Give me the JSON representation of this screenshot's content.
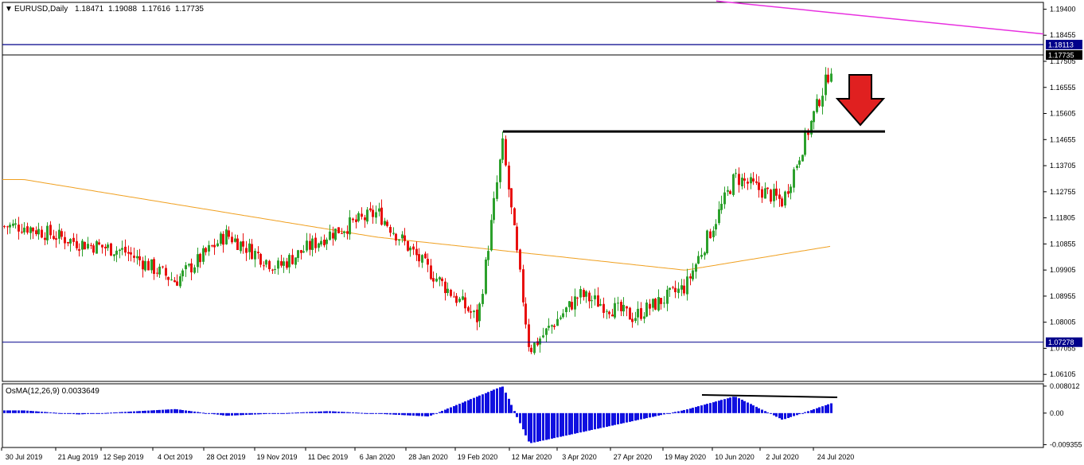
{
  "header": {
    "symbol": "EURUSD,Daily",
    "open": "1.18471",
    "high": "1.19088",
    "low": "1.17616",
    "close": "1.17735"
  },
  "osma": {
    "title": "OsMA(12,26,9) 0.0033649",
    "ticks": [
      "0.008012",
      "0.00",
      "-0.009355"
    ]
  },
  "price_axis_ticks": [
    "1.19400",
    "1.18455",
    "1.17505",
    "1.16555",
    "1.15605",
    "1.14655",
    "1.13705",
    "1.12755",
    "1.11805",
    "1.10855",
    "1.09905",
    "1.08955",
    "1.08005",
    "1.07055",
    "1.06105"
  ],
  "price_tags": {
    "resistance": "1.18113",
    "current": "1.17735",
    "support": "1.07278"
  },
  "date_labels": [
    "30 Jul 2019",
    "21 Aug 2019",
    "12 Sep 2019",
    "4 Oct 2019",
    "28 Oct 2019",
    "19 Nov 2019",
    "11 Dec 2019",
    "6 Jan 2020",
    "28 Jan 2020",
    "19 Feb 2020",
    "12 Mar 2020",
    "3 Apr 2020",
    "27 Apr 2020",
    "19 May 2020",
    "10 Jun 2020",
    "2 Jul 2020",
    "24 Jul 2020"
  ],
  "colors": {
    "bull": "#2ca02c",
    "bear": "#e8100f",
    "ma": "#f0a020",
    "trendline": "#e830e0",
    "hline": "#00008b",
    "osma": "#1010e0",
    "arrow": "#e02020"
  },
  "chart_data": {
    "type": "candlestick",
    "symbol": "EURUSD",
    "timeframe": "Daily",
    "ylim": [
      1.0585,
      1.1965
    ],
    "osma_ylim": [
      -0.0102,
      0.0087
    ],
    "close_anchors": [
      {
        "date": "30 Jul 2019",
        "close": 1.115
      },
      {
        "date": "21 Aug 2019",
        "close": 1.109
      },
      {
        "date": "12 Sep 2019",
        "close": 1.106
      },
      {
        "date": "4 Oct 2019",
        "close": 1.095
      },
      {
        "date": "28 Oct 2019",
        "close": 1.112
      },
      {
        "date": "19 Nov 2019",
        "close": 1.1
      },
      {
        "date": "11 Dec 2019",
        "close": 1.112
      },
      {
        "date": "6 Jan 2020",
        "close": 1.12
      },
      {
        "date": "28 Jan 2020",
        "close": 1.099
      },
      {
        "date": "19 Feb 2020",
        "close": 1.081
      },
      {
        "date": "9 Mar 2020",
        "close": 1.145
      },
      {
        "date": "20 Mar 2020",
        "close": 1.07
      },
      {
        "date": "3 Apr 2020",
        "close": 1.09
      },
      {
        "date": "27 Apr 2020",
        "close": 1.082
      },
      {
        "date": "19 May 2020",
        "close": 1.093
      },
      {
        "date": "10 Jun 2020",
        "close": 1.133
      },
      {
        "date": "2 Jul 2020",
        "close": 1.124
      },
      {
        "date": "24 Jul 2020",
        "close": 1.178
      }
    ],
    "moving_average": [
      {
        "date": "30 Jul 2019",
        "value": 1.132
      },
      {
        "date": "6 Jan 2020",
        "value": 1.111
      },
      {
        "date": "19 May 2020",
        "value": 1.099
      },
      {
        "date": "24 Jul 2020",
        "value": 1.108
      }
    ],
    "horizontal_levels": [
      1.18113,
      1.17735,
      1.07278
    ],
    "black_level": 1.1495,
    "trendline": [
      {
        "date": "24 Jun 2020",
        "value": 1.197
      },
      {
        "date": "end",
        "value": 1.185
      }
    ],
    "osma_anchors": [
      {
        "date": "30 Jul 2019",
        "value": 0.0008
      },
      {
        "date": "21 Aug 2019",
        "value": -0.0004
      },
      {
        "date": "4 Oct 2019",
        "value": 0.0012
      },
      {
        "date": "28 Oct 2019",
        "value": -0.0008
      },
      {
        "date": "11 Dec 2019",
        "value": 0.0006
      },
      {
        "date": "28 Jan 2020",
        "value": -0.001
      },
      {
        "date": "9 Mar 2020",
        "value": 0.008
      },
      {
        "date": "20 Mar 2020",
        "value": -0.009
      },
      {
        "date": "19 May 2020",
        "value": 0.001
      },
      {
        "date": "10 Jun 2020",
        "value": 0.005
      },
      {
        "date": "2 Jul 2020",
        "value": -0.002
      },
      {
        "date": "24 Jul 2020",
        "value": 0.0034
      }
    ]
  }
}
